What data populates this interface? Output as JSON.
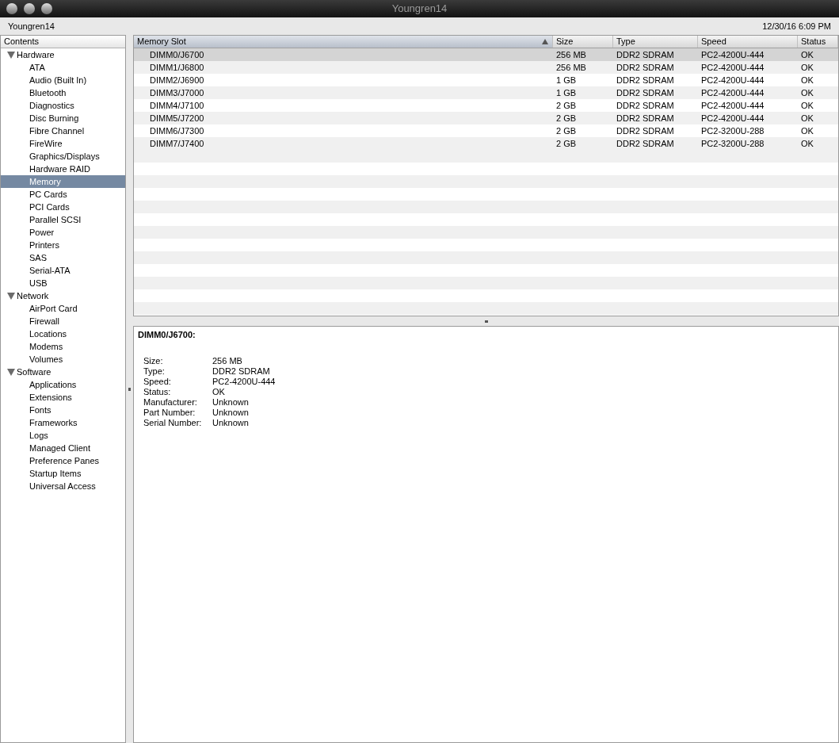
{
  "window": {
    "title": "Youngren14"
  },
  "header": {
    "computer_name": "Youngren14",
    "date_time": "12/30/16 6:09 PM"
  },
  "sidebar": {
    "heading": "Contents",
    "items": [
      {
        "label": "Hardware",
        "expanded": true,
        "selected": false,
        "children": [
          {
            "label": "ATA",
            "selected": false
          },
          {
            "label": "Audio (Built In)",
            "selected": false
          },
          {
            "label": "Bluetooth",
            "selected": false
          },
          {
            "label": "Diagnostics",
            "selected": false
          },
          {
            "label": "Disc Burning",
            "selected": false
          },
          {
            "label": "Fibre Channel",
            "selected": false
          },
          {
            "label": "FireWire",
            "selected": false
          },
          {
            "label": "Graphics/Displays",
            "selected": false
          },
          {
            "label": "Hardware RAID",
            "selected": false
          },
          {
            "label": "Memory",
            "selected": true
          },
          {
            "label": "PC Cards",
            "selected": false
          },
          {
            "label": "PCI Cards",
            "selected": false
          },
          {
            "label": "Parallel SCSI",
            "selected": false
          },
          {
            "label": "Power",
            "selected": false
          },
          {
            "label": "Printers",
            "selected": false
          },
          {
            "label": "SAS",
            "selected": false
          },
          {
            "label": "Serial-ATA",
            "selected": false
          },
          {
            "label": "USB",
            "selected": false
          }
        ]
      },
      {
        "label": "Network",
        "expanded": true,
        "selected": false,
        "children": [
          {
            "label": "AirPort Card",
            "selected": false
          },
          {
            "label": "Firewall",
            "selected": false
          },
          {
            "label": "Locations",
            "selected": false
          },
          {
            "label": "Modems",
            "selected": false
          },
          {
            "label": "Volumes",
            "selected": false
          }
        ]
      },
      {
        "label": "Software",
        "expanded": true,
        "selected": false,
        "children": [
          {
            "label": "Applications",
            "selected": false
          },
          {
            "label": "Extensions",
            "selected": false
          },
          {
            "label": "Fonts",
            "selected": false
          },
          {
            "label": "Frameworks",
            "selected": false
          },
          {
            "label": "Logs",
            "selected": false
          },
          {
            "label": "Managed Client",
            "selected": false
          },
          {
            "label": "Preference Panes",
            "selected": false
          },
          {
            "label": "Startup Items",
            "selected": false
          },
          {
            "label": "Universal Access",
            "selected": false
          }
        ]
      }
    ]
  },
  "table": {
    "columns": [
      {
        "label": "Memory Slot",
        "sorted": true
      },
      {
        "label": "Size",
        "sorted": false
      },
      {
        "label": "Type",
        "sorted": false
      },
      {
        "label": "Speed",
        "sorted": false
      },
      {
        "label": "Status",
        "sorted": false
      }
    ],
    "rows": [
      {
        "cells": [
          "DIMM0/J6700",
          "256 MB",
          "DDR2 SDRAM",
          "PC2-4200U-444",
          "OK"
        ],
        "selected": true
      },
      {
        "cells": [
          "DIMM1/J6800",
          "256 MB",
          "DDR2 SDRAM",
          "PC2-4200U-444",
          "OK"
        ],
        "selected": false
      },
      {
        "cells": [
          "DIMM2/J6900",
          "1 GB",
          "DDR2 SDRAM",
          "PC2-4200U-444",
          "OK"
        ],
        "selected": false
      },
      {
        "cells": [
          "DIMM3/J7000",
          "1 GB",
          "DDR2 SDRAM",
          "PC2-4200U-444",
          "OK"
        ],
        "selected": false
      },
      {
        "cells": [
          "DIMM4/J7100",
          "2 GB",
          "DDR2 SDRAM",
          "PC2-4200U-444",
          "OK"
        ],
        "selected": false
      },
      {
        "cells": [
          "DIMM5/J7200",
          "2 GB",
          "DDR2 SDRAM",
          "PC2-4200U-444",
          "OK"
        ],
        "selected": false
      },
      {
        "cells": [
          "DIMM6/J7300",
          "2 GB",
          "DDR2 SDRAM",
          "PC2-3200U-288",
          "OK"
        ],
        "selected": false
      },
      {
        "cells": [
          "DIMM7/J7400",
          "2 GB",
          "DDR2 SDRAM",
          "PC2-3200U-288",
          "OK"
        ],
        "selected": false
      }
    ]
  },
  "detail": {
    "title": "DIMM0/J6700:",
    "fields": [
      {
        "label": "Size:",
        "value": "256 MB"
      },
      {
        "label": "Type:",
        "value": "DDR2 SDRAM"
      },
      {
        "label": "Speed:",
        "value": "PC2-4200U-444"
      },
      {
        "label": "Status:",
        "value": "OK"
      },
      {
        "label": "Manufacturer:",
        "value": "Unknown"
      },
      {
        "label": "Part Number:",
        "value": "Unknown"
      },
      {
        "label": "Serial Number:",
        "value": "Unknown"
      }
    ]
  }
}
